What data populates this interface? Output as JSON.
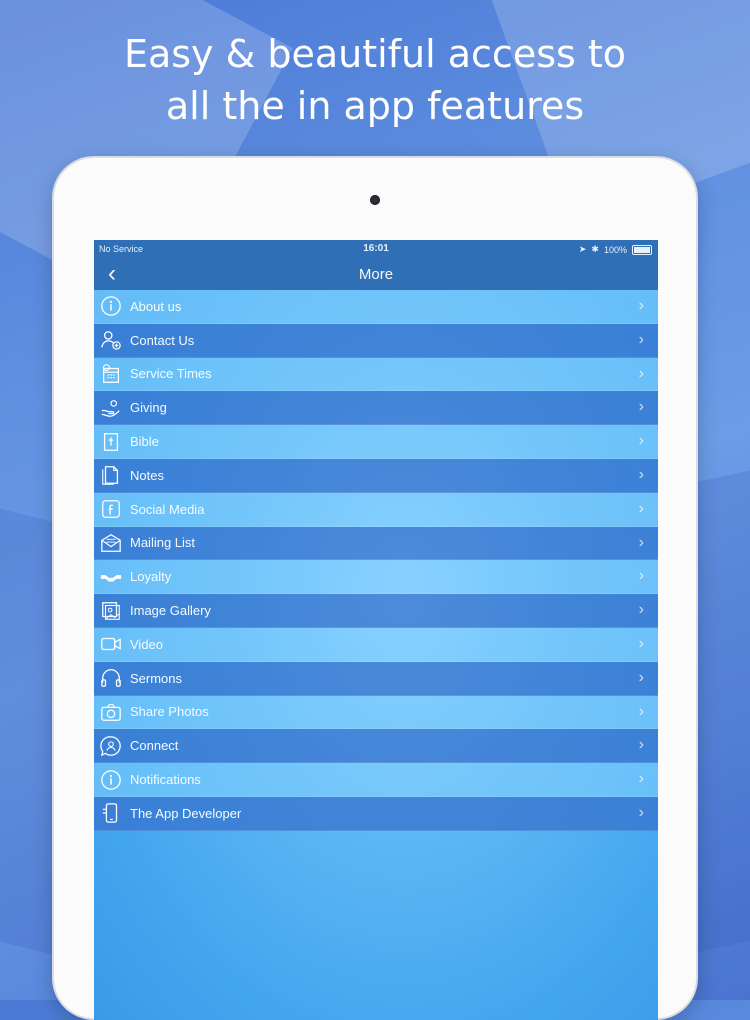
{
  "headline": {
    "line1": "Easy & beautiful access to",
    "line2": "all the in app features"
  },
  "statusbar": {
    "carrier": "No Service",
    "time": "16:01",
    "battery": "100%"
  },
  "navbar": {
    "back_icon": "chevron-left-icon",
    "title": "More"
  },
  "menu": {
    "items": [
      {
        "label": "About us",
        "icon": "info-icon"
      },
      {
        "label": "Contact Us",
        "icon": "contact-add-icon"
      },
      {
        "label": "Service Times",
        "icon": "calendar-clock-icon"
      },
      {
        "label": "Giving",
        "icon": "giving-hand-icon"
      },
      {
        "label": "Bible",
        "icon": "bible-icon"
      },
      {
        "label": "Notes",
        "icon": "notes-icon"
      },
      {
        "label": "Social Media",
        "icon": "facebook-icon"
      },
      {
        "label": "Mailing List",
        "icon": "envelope-icon"
      },
      {
        "label": "Loyalty",
        "icon": "handshake-icon"
      },
      {
        "label": "Image Gallery",
        "icon": "image-gallery-icon"
      },
      {
        "label": "Video",
        "icon": "video-camera-icon"
      },
      {
        "label": "Sermons",
        "icon": "headphones-icon"
      },
      {
        "label": "Share Photos",
        "icon": "camera-icon"
      },
      {
        "label": "Connect",
        "icon": "connect-chat-icon"
      },
      {
        "label": "Notifications",
        "icon": "notification-info-icon"
      },
      {
        "label": "The App Developer",
        "icon": "phone-developer-icon"
      }
    ]
  },
  "colors": {
    "navbar": "#2f6fb6",
    "row_light": "#84d2ff",
    "row_dark": "#3470cc"
  }
}
